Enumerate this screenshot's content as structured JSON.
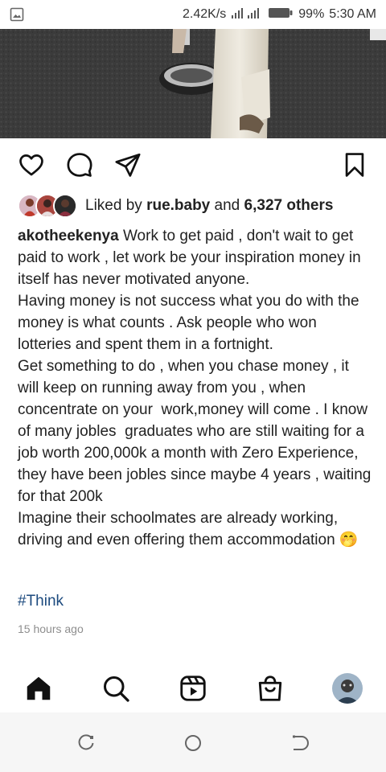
{
  "status_bar": {
    "speed": "2.42K/s",
    "battery": "99%",
    "time": "5:30 AM"
  },
  "post": {
    "liked_by_prefix": "Liked by",
    "liked_by_user": "rue.baby",
    "liked_by_and": "and",
    "liked_by_others": "6,327 others",
    "username": "akotheekenya",
    "caption": "Work to get paid , don't wait to get paid to work , let work be your inspiration money in itself has never motivated anyone.\nHaving money is not success what you do with the money is what counts . Ask people who won lotteries and spent them in a fortnight.\nGet something to do , when you chase money , it will keep on running away from you , when concentrate on your  work,money will come . I know of many jobles  graduates who are still waiting for a job worth 200,000k a month with Zero Experience,  they have been jobles since maybe 4 years , waiting for that 200k\nImagine their schoolmates are already working, driving and even offering them accommodation 🤭",
    "hashtag": "#Think",
    "timestamp": "15 hours ago"
  },
  "icons": {
    "like": "heart-icon",
    "comment": "comment-icon",
    "share": "send-icon",
    "save": "bookmark-icon",
    "home": "home-icon",
    "search": "search-icon",
    "reels": "reels-icon",
    "shop": "shop-icon"
  },
  "colors": {
    "hashtag": "#1c4a7e",
    "timestamp": "#8e8e8e"
  }
}
